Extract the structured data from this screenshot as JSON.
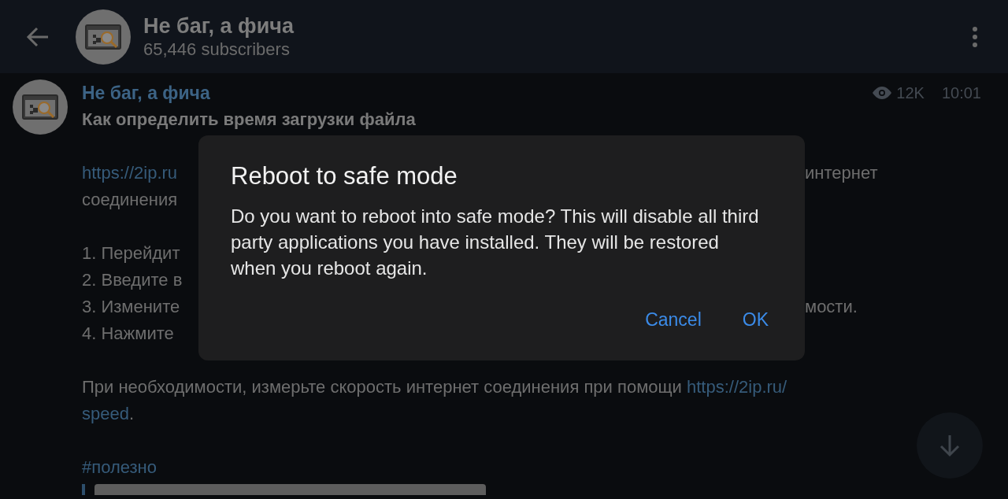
{
  "header": {
    "title": "Не баг, а фича",
    "subtitle": "65,446 subscribers"
  },
  "post": {
    "author": "Не баг, а фича",
    "views": "12K",
    "time": "10:01",
    "heading": "Как определить время загрузки файла",
    "paragraphs": [
      {
        "lines": [
          {
            "before_dialog": [
              {
                "kind": "link",
                "text": "https://2ip.ru"
              }
            ],
            "after_dialog": [
              {
                "kind": "text",
                "text": "интернет"
              }
            ]
          },
          {
            "before_dialog": [
              {
                "kind": "text",
                "text": "соединения"
              }
            ]
          }
        ]
      },
      {
        "lines": [
          {
            "before_dialog": [
              {
                "kind": "text",
                "text": "1. Перейдит"
              }
            ]
          },
          {
            "before_dialog": [
              {
                "kind": "text",
                "text": "2. Введите в"
              }
            ]
          },
          {
            "before_dialog": [
              {
                "kind": "text",
                "text": "3. Измените"
              }
            ],
            "after_dialog": [
              {
                "kind": "text",
                "text": "мости."
              }
            ]
          },
          {
            "before_dialog": [
              {
                "kind": "text",
                "text": "4. Нажмите"
              }
            ]
          }
        ]
      },
      {
        "lines": [
          {
            "segments": [
              {
                "kind": "text",
                "text": "При необходимости, измерьте скорость интернет соединения при помощи "
              },
              {
                "kind": "link",
                "text": "https://2ip.ru/"
              }
            ]
          },
          {
            "segments": [
              {
                "kind": "link",
                "text": "speed"
              },
              {
                "kind": "text",
                "text": "."
              }
            ]
          }
        ]
      },
      {
        "lines": [
          {
            "segments": [
              {
                "kind": "tag",
                "text": "#полезно"
              }
            ]
          }
        ]
      }
    ]
  },
  "dialog": {
    "title": "Reboot to safe mode",
    "message": "Do you want to reboot into safe mode? This will disable all third party applications you have installed. They will be restored when you reboot again.",
    "buttons": [
      "Cancel",
      "OK"
    ]
  }
}
